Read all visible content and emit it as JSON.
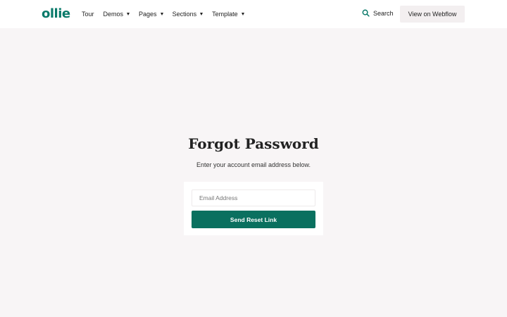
{
  "navbar": {
    "logo": "ollie",
    "links": [
      {
        "label": "Tour",
        "has_dropdown": false
      },
      {
        "label": "Demos",
        "has_dropdown": true
      },
      {
        "label": "Pages",
        "has_dropdown": true
      },
      {
        "label": "Sections",
        "has_dropdown": true
      },
      {
        "label": "Template",
        "has_dropdown": true
      }
    ],
    "search_label": "Search",
    "cta_label": "View on Webflow"
  },
  "main": {
    "title": "Forgot Password",
    "subtitle": "Enter your account email address below.",
    "form": {
      "email_placeholder": "Email Address",
      "email_value": "",
      "submit_label": "Send Reset Link"
    }
  },
  "colors": {
    "brand": "#0a7a6a",
    "button": "#0a705f",
    "page_background": "#f8f5f6"
  },
  "icons": {
    "search": "search-icon",
    "dropdown": "caret-down-icon"
  }
}
